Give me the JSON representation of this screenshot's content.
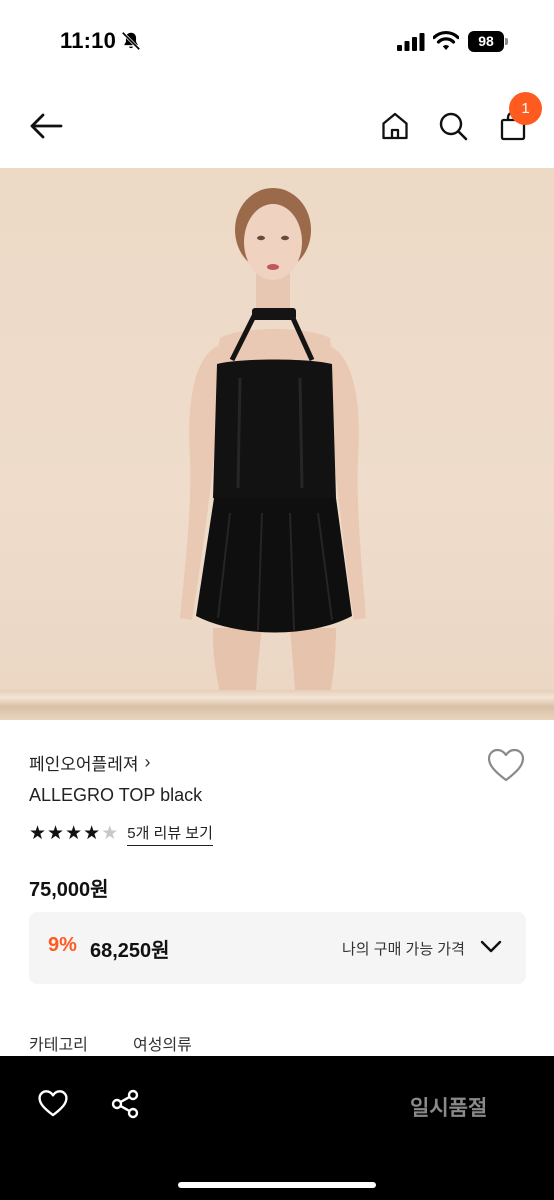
{
  "status_bar": {
    "time": "11:10",
    "battery_level": "98",
    "icons": [
      "bell-slash-icon",
      "signal-icon",
      "wifi-icon",
      "battery-icon"
    ]
  },
  "nav": {
    "icons": [
      "back-arrow-icon",
      "home-icon",
      "search-icon",
      "shopping-bag-icon"
    ],
    "cart_count": "1",
    "badge_color": "#ff5a1f"
  },
  "product": {
    "brand": "페인오어플레져",
    "brand_chevron": "›",
    "name": "ALLEGRO TOP black",
    "rating": 4,
    "rating_max": 5,
    "review_link": "5개 리뷰 보기",
    "price": "75,000원"
  },
  "discount": {
    "rate": "9%",
    "price": "68,250원",
    "my_price_label": "나의 구매 가능 가격",
    "accent_color": "#ff5a1f"
  },
  "details": {
    "category_label": "카테고리",
    "category_value": "여성의류"
  },
  "bottom_bar": {
    "soldout_label": "일시품절",
    "icons": [
      "heart-icon",
      "share-icon"
    ]
  }
}
